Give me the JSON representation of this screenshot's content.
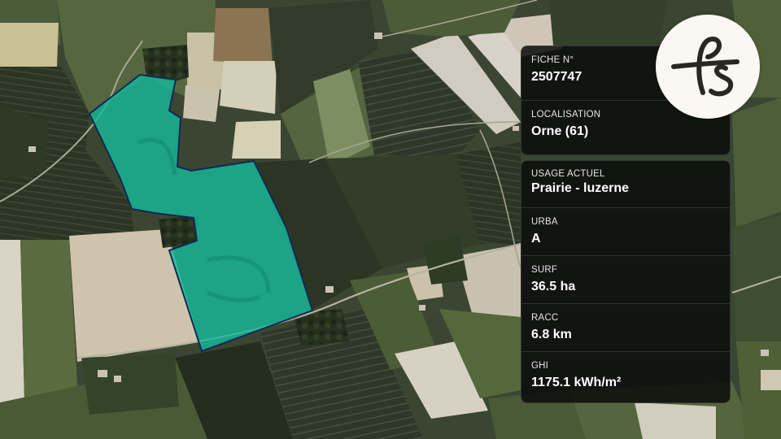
{
  "parcel": {
    "fiche_label": "FICHE N°",
    "fiche_value": "2507747",
    "localisation_label": "LOCALISATION",
    "localisation_value": "Orne (61)",
    "usage_label": "USAGE ACTUEL",
    "usage_value": "Prairie - luzerne",
    "urba_label": "URBA",
    "urba_value": "A",
    "surf_label": "SURF",
    "surf_value": "36.5 ha",
    "racc_label": "RACC",
    "racc_value": "6.8 km",
    "ghi_label": "GHI",
    "ghi_value": "1175.1 kWh/m²"
  },
  "colors": {
    "parcel_fill": "#17b898",
    "parcel_stroke": "#0e2a55",
    "logo_ink": "#2a2623"
  },
  "logo": {
    "icon": "fs-monogram-logo"
  }
}
